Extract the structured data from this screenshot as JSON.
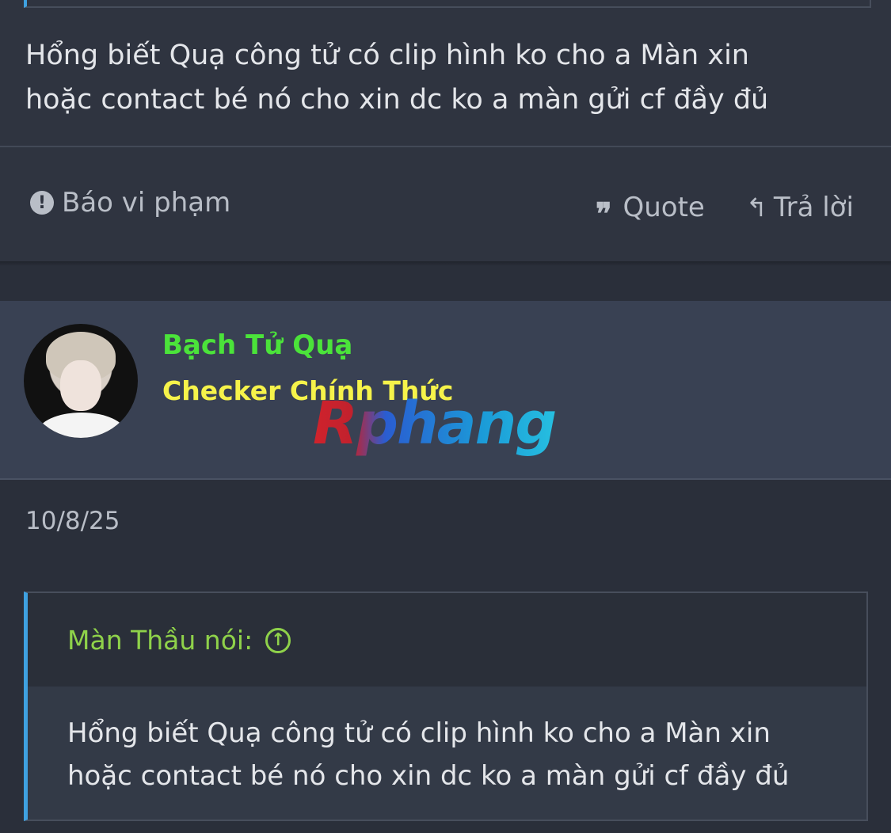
{
  "previous_post": {
    "body_line1": "Hổng biết Quạ công tử có clip hình ko cho a Màn xin",
    "body_line2": "hoặc contact bé nó cho xin dc ko a màn gửi cf đầy đủ"
  },
  "actions": {
    "report_label": "Báo vi phạm",
    "quote_label": "Quote",
    "reply_label": "Trả lời",
    "report_icon": "exclamation-circle-icon",
    "quote_icon": "quote-icon",
    "reply_icon": "reply-arrow-icon"
  },
  "user": {
    "name": "Bạch Tử Quạ",
    "title": "Checker Chính Thức",
    "name_color": "#4be33a",
    "title_color": "#f6f34a"
  },
  "watermark": "Rphang",
  "post": {
    "date": "10/8/25",
    "quote": {
      "author": "Màn Thầu nói:",
      "jump_icon": "arrow-up-circle-icon",
      "line1": "Hổng biết Quạ công tử có clip hình ko cho a Màn xin",
      "line2": "hoặc contact bé nó cho xin dc ko a màn gửi cf đầy đủ"
    }
  },
  "colors": {
    "accent_bar": "#3fa1e0",
    "quote_author": "#8fd24a",
    "background": "#2a2f3a"
  }
}
